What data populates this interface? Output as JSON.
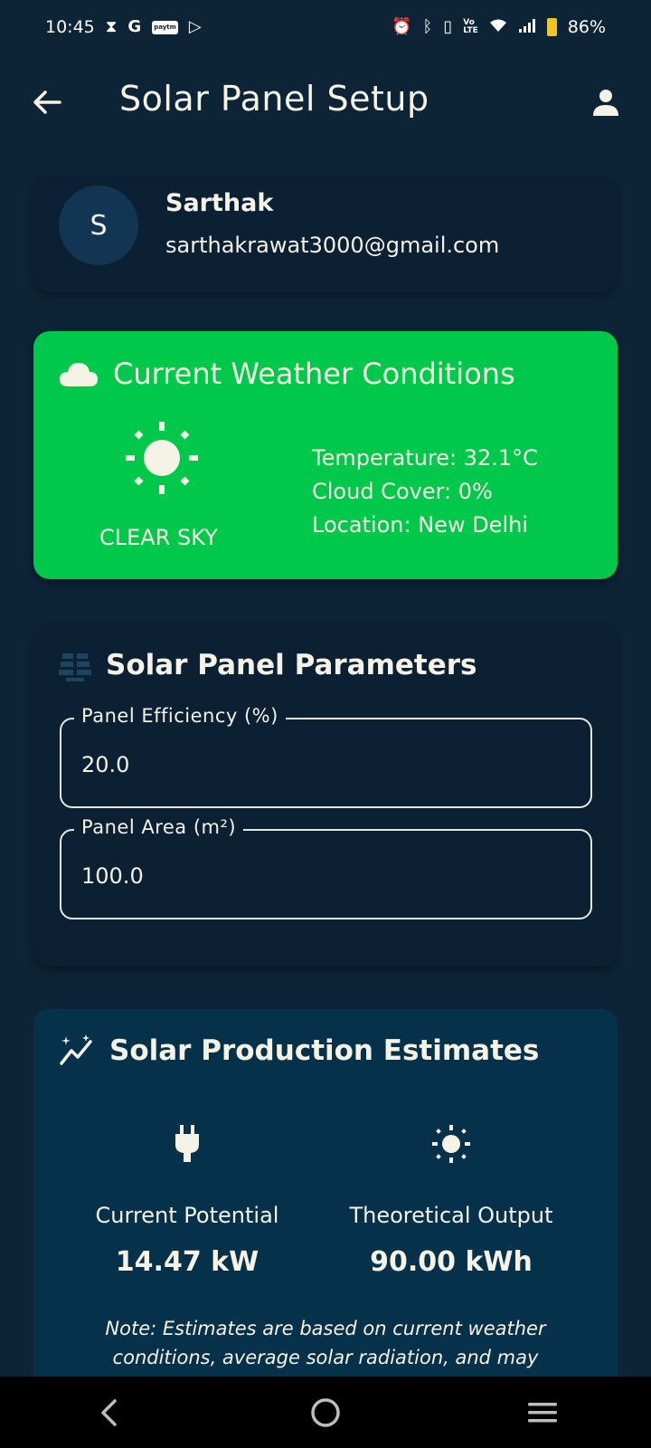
{
  "status_bar": {
    "time": "10:45",
    "battery": "86%",
    "left_icons": [
      "hourglass-icon",
      "google-icon",
      "paytm-icon",
      "play-icon"
    ],
    "right_icons": [
      "alarm-icon",
      "bluetooth-icon",
      "vibrate-icon",
      "volte-icon",
      "wifi-icon",
      "signal-icon",
      "battery-icon"
    ]
  },
  "app_bar": {
    "title": "Solar Panel Setup"
  },
  "user": {
    "initial": "S",
    "name": "Sarthak",
    "email": "sarthakrawat3000@gmail.com"
  },
  "weather": {
    "title": "Current Weather Conditions",
    "condition": "CLEAR SKY",
    "temperature": "Temperature: 32.1°C",
    "cloud_cover": "Cloud Cover: 0%",
    "location": "Location: New Delhi",
    "card_color": "#00c84a"
  },
  "parameters": {
    "title": "Solar Panel Parameters",
    "efficiency_label": "Panel Efficiency (%)",
    "efficiency_value": "20.0",
    "area_label": "Panel Area (m²)",
    "area_value": "100.0"
  },
  "estimates": {
    "title": "Solar Production Estimates",
    "current_label": "Current Potential",
    "current_value": "14.47 kW",
    "theoretical_label": "Theoretical Output",
    "theoretical_value": "90.00 kWh",
    "note": "Note: Estimates are based on current weather conditions, average solar radiation, and may"
  },
  "colors": {
    "background": "#0c2436",
    "card_dark": "#0b2133",
    "estimates_card": "#06314b",
    "text": "#f5f2e6"
  }
}
